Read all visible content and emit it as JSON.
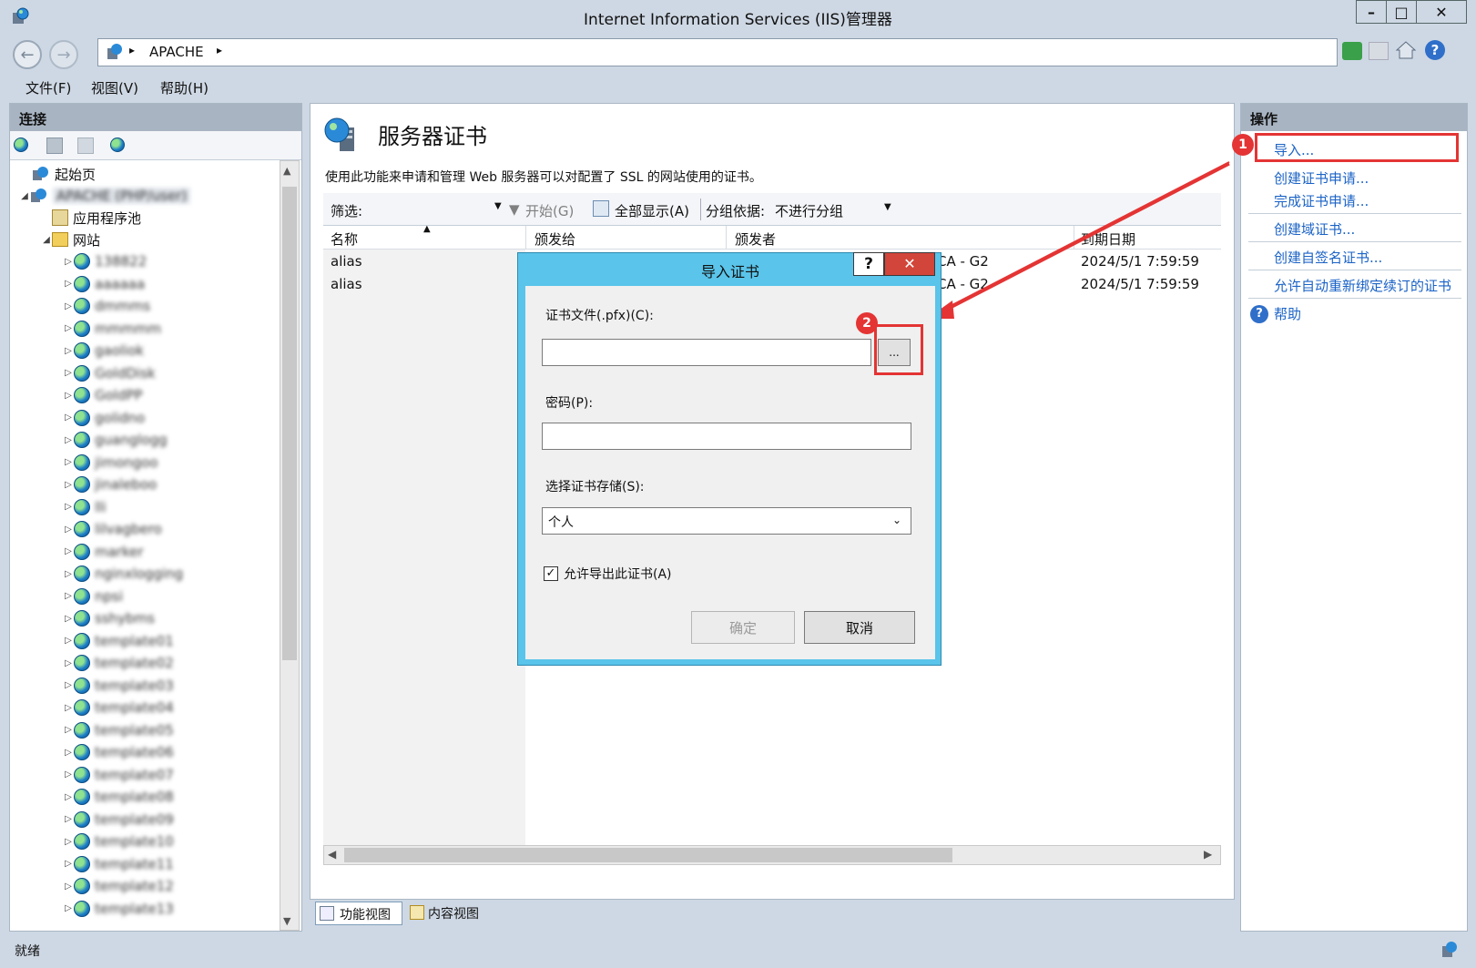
{
  "window": {
    "title": "Internet Information Services (IIS)管理器",
    "minimize": "–",
    "maximize": "□",
    "close": "✕"
  },
  "address": {
    "back": "←",
    "forward": "→",
    "path": "APACHE",
    "separator": "▸"
  },
  "menu": {
    "file": "文件(F)",
    "view": "视图(V)",
    "help": "帮助(H)"
  },
  "connections": {
    "header": "连接",
    "start_page": "起始页",
    "server": "APACHE (PHP/user)",
    "app_pools": "应用程序池",
    "sites": "网站",
    "site_items": [
      "138822",
      "aaaaaa",
      "dmmms",
      "mmmmm",
      "gaoliok",
      "GoldDisk",
      "GoldPP",
      "golidno",
      "guanglogg",
      "jimongoo",
      "jinaleboo",
      "lli",
      "lilvagbero",
      "marker",
      "nginxlogging",
      "npsi",
      "sshybms",
      "template01",
      "template02",
      "template03",
      "template04",
      "template05",
      "template06",
      "template07",
      "template08",
      "template09",
      "template10",
      "template11",
      "template12",
      "template13"
    ]
  },
  "center": {
    "title": "服务器证书",
    "description": "使用此功能来申请和管理 Web 服务器可以对配置了 SSL 的网站使用的证书。",
    "filter_label": "筛选:",
    "start_btn": "开始(G)",
    "show_all": "全部显示(A)",
    "group_by": "分组依据:",
    "group_value": "不进行分组",
    "columns": [
      "名称",
      "颁发给",
      "颁发者",
      "到期日期"
    ],
    "rows": [
      {
        "name": "alias",
        "issuer_suffix": "CA - G2",
        "expiry": "2024/5/1 7:59:59"
      },
      {
        "name": "alias",
        "issuer_suffix": "CA - G2",
        "expiry": "2024/5/1 7:59:59"
      }
    ],
    "tab_feature": "功能视图",
    "tab_content": "内容视图"
  },
  "actions": {
    "header": "操作",
    "items": [
      "导入...",
      "创建证书申请...",
      "完成证书申请...",
      "创建域证书...",
      "创建自签名证书...",
      "允许自动重新绑定续订的证书"
    ],
    "help": "帮助"
  },
  "dialog": {
    "title": "导入证书",
    "help_btn": "?",
    "close_btn": "✕",
    "cert_file_label": "证书文件(.pfx)(C):",
    "cert_file_value": "",
    "browse_btn": "...",
    "password_label": "密码(P):",
    "password_value": "",
    "store_label": "选择证书存储(S):",
    "store_value": "个人",
    "exportable_label": "允许导出此证书(A)",
    "exportable_checked": true,
    "ok_btn": "确定",
    "cancel_btn": "取消"
  },
  "annotations": {
    "marker1": "1",
    "marker2": "2",
    "color": "#e43434"
  },
  "status": {
    "text": "就绪"
  }
}
